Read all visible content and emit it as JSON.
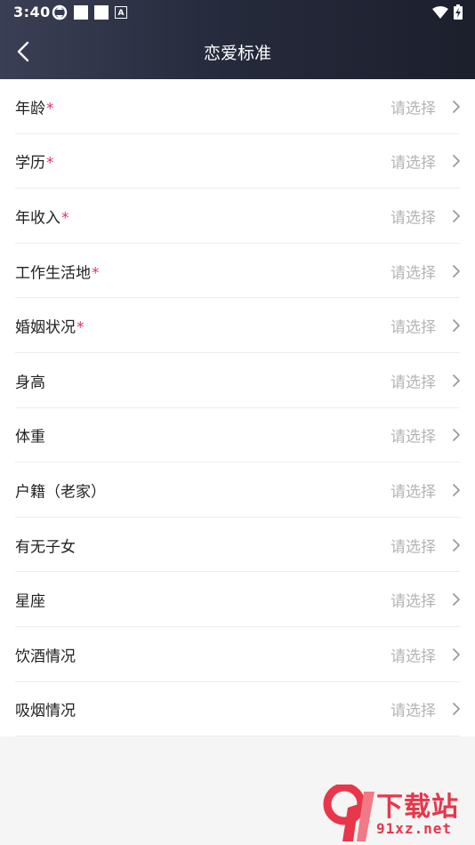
{
  "status": {
    "time": "3:40",
    "left_badge": "A"
  },
  "nav": {
    "title": "恋爱标准"
  },
  "rows": [
    {
      "label": "年龄",
      "required": "*",
      "value": "请选择"
    },
    {
      "label": "学历",
      "required": "*",
      "value": "请选择"
    },
    {
      "label": "年收入",
      "required": "*",
      "value": "请选择"
    },
    {
      "label": "工作生活地",
      "required": "*",
      "value": "请选择"
    },
    {
      "label": "婚姻状况",
      "required": "*",
      "value": "请选择"
    },
    {
      "label": "身高",
      "required": "",
      "value": "请选择"
    },
    {
      "label": "体重",
      "required": "",
      "value": "请选择"
    },
    {
      "label": "户籍（老家）",
      "required": "",
      "value": "请选择"
    },
    {
      "label": "有无子女",
      "required": "",
      "value": "请选择"
    },
    {
      "label": "星座",
      "required": "",
      "value": "请选择"
    },
    {
      "label": "饮酒情况",
      "required": "",
      "value": "请选择"
    },
    {
      "label": "吸烟情况",
      "required": "",
      "value": "请选择"
    }
  ],
  "watermark": {
    "title": "下载站",
    "url": "91xz.net",
    "logo_text": "9"
  },
  "colors": {
    "header": "#262b3d",
    "required": "#e5306b",
    "placeholder": "#b4b4b4",
    "watermark": "#e8364a"
  },
  "icons": {
    "back": "chevron-left-icon",
    "row_arrow": "chevron-right-icon"
  }
}
